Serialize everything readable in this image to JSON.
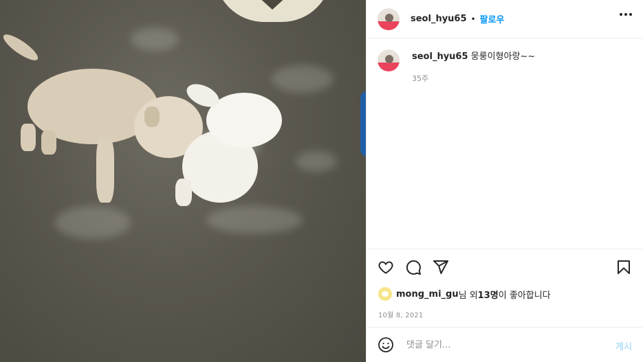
{
  "post": {
    "username": "seol_hyu65",
    "follow_label": "팔로우",
    "separator": "•",
    "caption_text": "뭉룽이형아랑~~",
    "caption_time": "35주",
    "likes": {
      "user": "mong_mi_gu",
      "connector": "님 외 ",
      "count": "13명",
      "suffix": "이 좋아합니다"
    },
    "date": "10월 8, 2021"
  },
  "comment": {
    "placeholder": "댓글 달기...",
    "post_label": "게시"
  },
  "icons": {
    "more": "more-options-icon",
    "like": "heart-icon",
    "comment": "comment-icon",
    "share": "paper-plane-icon",
    "save": "bookmark-icon",
    "emoji": "emoji-icon"
  },
  "colors": {
    "link": "#0095f6",
    "post_disabled": "#b2dffc",
    "secondary_text": "#8e8e8e",
    "border": "#efefef"
  }
}
